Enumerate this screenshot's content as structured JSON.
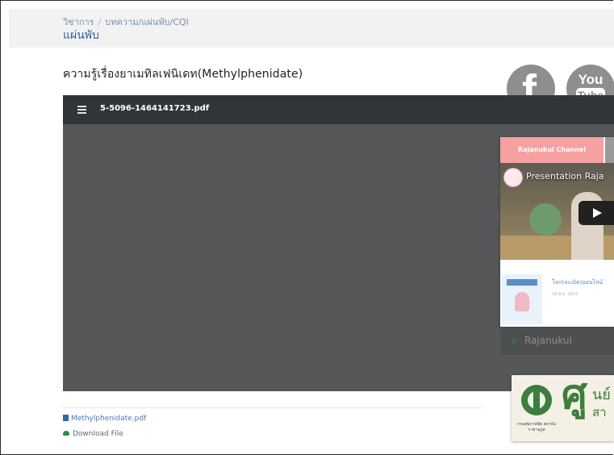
{
  "breadcrumb": {
    "root": "วิชาการ",
    "separator": "/",
    "current": "บทความ/แผ่นพับ/CQI"
  },
  "section_title": "แผ่นพับ",
  "page_title": "ความรู้เรื่องยาเมทิลเฟนิเดท(Methylphenidate)",
  "social": {
    "facebook_letter": "f",
    "youtube_top": "You",
    "youtube_bottom": "Tube"
  },
  "viewer": {
    "file_name": "5-5096-1464141723.pdf"
  },
  "widget": {
    "active_tab": "Rajanukul Channel",
    "video_title": "Presentation Raja",
    "post_title": "โลก(ละเมิด)ออนไลน์",
    "post_date": "18 มี.ค. 2563"
  },
  "rajanukul_label": "Rajanukul",
  "banner": {
    "big_char": "ศู",
    "row1": "นย์",
    "row2": "สา",
    "dept": "กรมสุขภาพจิต สถาบันราชานุกูล"
  },
  "attachment": {
    "file_link": "Methylphenidate.pdf",
    "download_label": "Download File"
  },
  "colors": {
    "header_band": "#f2f2f2",
    "link_blue": "#2f5f9a",
    "viewer_bar": "#323538",
    "viewer_body": "#555759",
    "tab_active": "#f6a1a1",
    "brand_green": "#3d7d3d"
  }
}
